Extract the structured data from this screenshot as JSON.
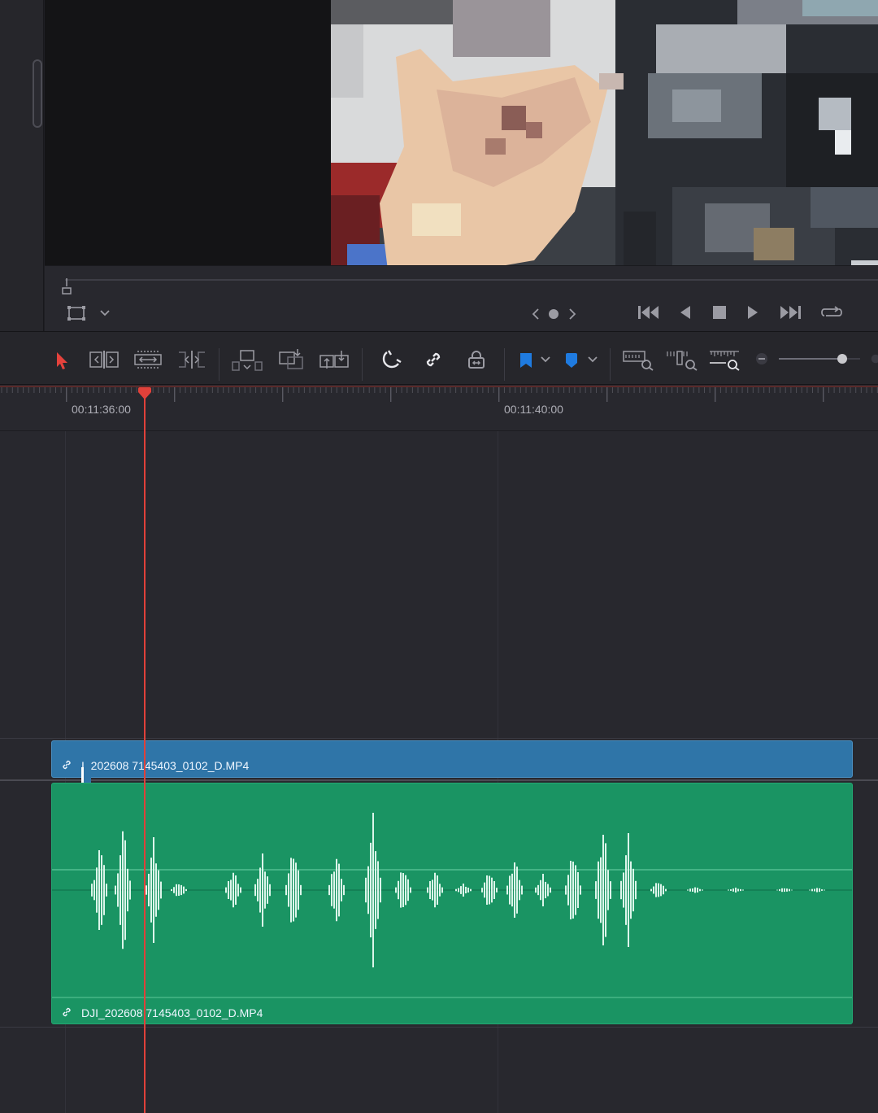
{
  "viewer": {
    "frame_description_icon": "video-frame-preview",
    "nav_prev": "‹",
    "nav_next": "›"
  },
  "transport": {
    "icons": [
      "go-to-start-icon",
      "play-reverse-icon",
      "stop-icon",
      "play-icon",
      "go-to-end-icon",
      "loop-icon"
    ]
  },
  "toolbar": {
    "icons": [
      "selection-pointer-icon",
      "trim-edit-icon",
      "dynamic-trim-icon",
      "blade-edit-icon",
      "overwrite-clip-icon",
      "replace-clip-icon",
      "place-on-top-icon",
      "snapping-icon",
      "linked-selection-icon",
      "position-lock-icon",
      "flag-icon",
      "marker-icon",
      "zoom-full-icon",
      "zoom-detail-icon",
      "zoom-custom-icon"
    ],
    "zoom_level": 0.78
  },
  "ruler": {
    "timecodes": [
      "00:11:36:00",
      "00:11:40:00"
    ]
  },
  "timeline": {
    "video_clip_label": "I_202608  7145403_0102_D.MP4",
    "audio_clip_label": "DJI_202608  7145403_0102_D.MP4"
  },
  "colors": {
    "playhead": "#e0413a",
    "video_clip": "#2f75a8",
    "audio_clip": "#1a9463",
    "selection_tool": "#e5423c",
    "flag": "#1f7be0"
  }
}
